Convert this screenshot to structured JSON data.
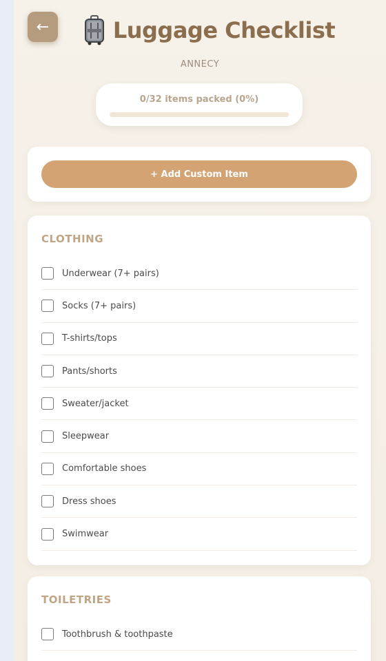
{
  "header": {
    "back_icon": "←",
    "title": "Luggage Checklist",
    "subtitle": "ANNECY",
    "icon": "suitcase-icon"
  },
  "progress": {
    "label": "0/32 items packed (0%)",
    "packed": 0,
    "total": 32,
    "percent": 0
  },
  "actions": {
    "add_label": "+ Add Custom Item"
  },
  "sections": [
    {
      "title": "CLOTHING",
      "items": [
        "Underwear (7+ pairs)",
        "Socks (7+ pairs)",
        "T-shirts/tops",
        "Pants/shorts",
        "Sweater/jacket",
        "Sleepwear",
        "Comfortable shoes",
        "Dress shoes",
        "Swimwear"
      ]
    },
    {
      "title": "TOILETRIES",
      "items": [
        "Toothbrush & toothpaste"
      ]
    }
  ],
  "colors": {
    "accent": "#d4a373",
    "title": "#8b6e4e",
    "back_button": "#b59c7e",
    "background": "#f5efe6"
  }
}
